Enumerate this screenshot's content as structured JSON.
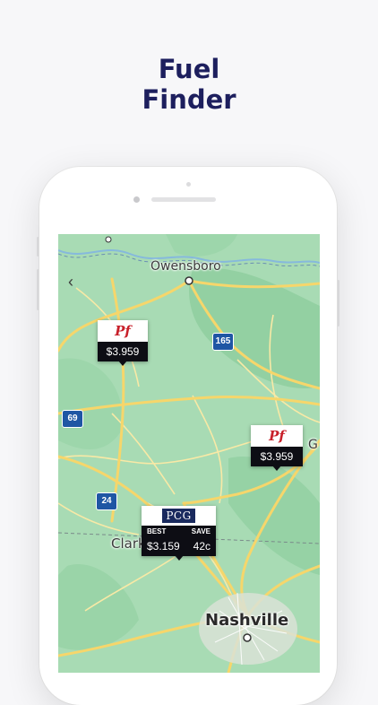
{
  "headline": {
    "line1": "Fuel",
    "line2": "Finder"
  },
  "map": {
    "cities": {
      "owensboro": "Owensboro",
      "clark": "Clark",
      "nashville": "Nashville",
      "edge_letter": "G"
    },
    "shields": {
      "i165": "165",
      "i69": "69",
      "i24": "24"
    },
    "back_icon": "chevron-left-icon"
  },
  "stations": [
    {
      "brand_logo": "Pf",
      "price": "$3.959"
    },
    {
      "brand_logo": "Pf",
      "price": "$3.959"
    }
  ],
  "best_station": {
    "brand_logo": "PCG",
    "best_label": "BEST",
    "save_label": "SAVE",
    "price": "$3.159",
    "savings": "42c"
  },
  "colors": {
    "headline": "#1d1f5e",
    "map_green": "#a8dbb4",
    "road_yellow": "#f6d66b",
    "price_bg": "#0d0d14",
    "brand_red": "#c8202a",
    "interstate_blue": "#1f56a4"
  }
}
